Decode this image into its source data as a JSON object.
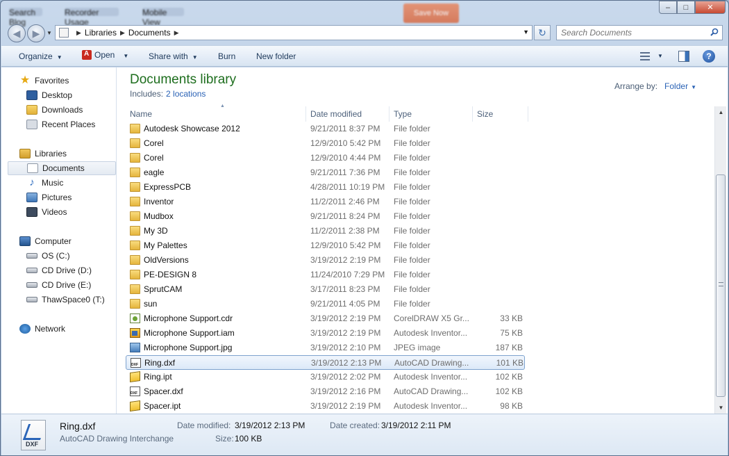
{
  "window": {
    "background_titles": [
      "Search Blog",
      "Recorder Usage",
      "Mobile View",
      "Save Now"
    ]
  },
  "nav": {
    "breadcrumb": [
      "Libraries",
      "Documents"
    ],
    "search_placeholder": "Search Documents"
  },
  "toolbar": {
    "organize": "Organize",
    "open": "Open",
    "share_with": "Share with",
    "burn": "Burn",
    "new_folder": "New folder"
  },
  "sidebar": {
    "favorites": "Favorites",
    "favorites_items": [
      "Desktop",
      "Downloads",
      "Recent Places"
    ],
    "libraries": "Libraries",
    "libraries_items": [
      "Documents",
      "Music",
      "Pictures",
      "Videos"
    ],
    "computer": "Computer",
    "computer_items": [
      "OS (C:)",
      "CD Drive (D:)",
      "CD Drive (E:)",
      "ThawSpace0 (T:)"
    ],
    "network": "Network"
  },
  "library": {
    "title": "Documents library",
    "includes_label": "Includes:",
    "includes_link": "2 locations",
    "arrange_label": "Arrange by:",
    "arrange_value": "Folder"
  },
  "columns": {
    "name": "Name",
    "date": "Date modified",
    "type": "Type",
    "size": "Size"
  },
  "files": [
    {
      "name": "Autodesk Showcase 2012",
      "date": "9/21/2011 8:37 PM",
      "type": "File folder",
      "size": "",
      "icon": "folder"
    },
    {
      "name": "Corel",
      "date": "12/9/2010 5:42 PM",
      "type": "File folder",
      "size": "",
      "icon": "folder"
    },
    {
      "name": "Corel",
      "date": "12/9/2010 4:44 PM",
      "type": "File folder",
      "size": "",
      "icon": "folder"
    },
    {
      "name": "eagle",
      "date": "9/21/2011 7:36 PM",
      "type": "File folder",
      "size": "",
      "icon": "folder"
    },
    {
      "name": "ExpressPCB",
      "date": "4/28/2011 10:19 PM",
      "type": "File folder",
      "size": "",
      "icon": "folder"
    },
    {
      "name": "Inventor",
      "date": "11/2/2011 2:46 PM",
      "type": "File folder",
      "size": "",
      "icon": "folder"
    },
    {
      "name": "Mudbox",
      "date": "9/21/2011 8:24 PM",
      "type": "File folder",
      "size": "",
      "icon": "folder"
    },
    {
      "name": "My 3D",
      "date": "11/2/2011 2:38 PM",
      "type": "File folder",
      "size": "",
      "icon": "folder"
    },
    {
      "name": "My Palettes",
      "date": "12/9/2010 5:42 PM",
      "type": "File folder",
      "size": "",
      "icon": "folder"
    },
    {
      "name": "OldVersions",
      "date": "3/19/2012 2:19 PM",
      "type": "File folder",
      "size": "",
      "icon": "folder"
    },
    {
      "name": "PE-DESIGN 8",
      "date": "11/24/2010 7:29 PM",
      "type": "File folder",
      "size": "",
      "icon": "folder"
    },
    {
      "name": "SprutCAM",
      "date": "3/17/2011 8:23 PM",
      "type": "File folder",
      "size": "",
      "icon": "folder"
    },
    {
      "name": "sun",
      "date": "9/21/2011 4:05 PM",
      "type": "File folder",
      "size": "",
      "icon": "folder"
    },
    {
      "name": "Microphone Support.cdr",
      "date": "3/19/2012 2:19 PM",
      "type": "CorelDRAW X5 Gr...",
      "size": "33 KB",
      "icon": "cdr"
    },
    {
      "name": "Microphone Support.iam",
      "date": "3/19/2012 2:19 PM",
      "type": "Autodesk Inventor...",
      "size": "75 KB",
      "icon": "iam"
    },
    {
      "name": "Microphone Support.jpg",
      "date": "3/19/2012 2:10 PM",
      "type": "JPEG image",
      "size": "187 KB",
      "icon": "jpg"
    },
    {
      "name": "Ring.dxf",
      "date": "3/19/2012 2:13 PM",
      "type": "AutoCAD Drawing...",
      "size": "101 KB",
      "icon": "dxf",
      "selected": true
    },
    {
      "name": "Ring.ipt",
      "date": "3/19/2012 2:02 PM",
      "type": "Autodesk Inventor...",
      "size": "102 KB",
      "icon": "ipt"
    },
    {
      "name": "Spacer.dxf",
      "date": "3/19/2012 2:16 PM",
      "type": "AutoCAD Drawing...",
      "size": "102 KB",
      "icon": "dxf"
    },
    {
      "name": "Spacer.ipt",
      "date": "3/19/2012 2:19 PM",
      "type": "Autodesk Inventor...",
      "size": "98 KB",
      "icon": "ipt"
    }
  ],
  "details": {
    "name": "Ring.dxf",
    "kind": "AutoCAD Drawing Interchange",
    "modified_label": "Date modified:",
    "modified_value": "3/19/2012 2:13 PM",
    "size_label": "Size:",
    "size_value": "100 KB",
    "created_label": "Date created:",
    "created_value": "3/19/2012 2:11 PM"
  },
  "colors": {
    "library_title": "#1e6e1e",
    "link": "#2a62b5",
    "selection_border": "#7da2ce"
  }
}
